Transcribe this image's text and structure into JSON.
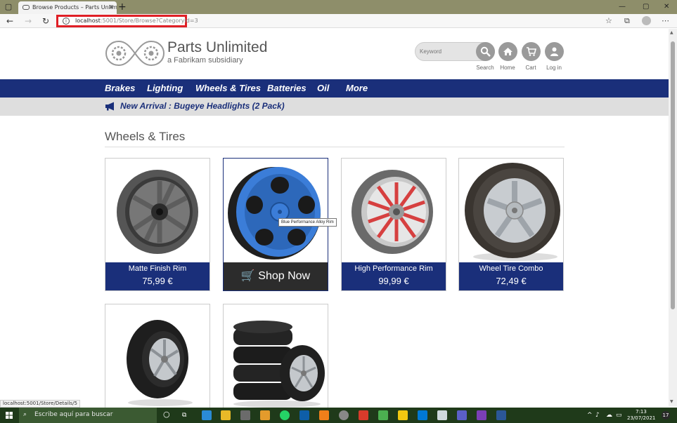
{
  "browser": {
    "tab_title": "Browse Products – Parts Unlimited",
    "url_host": "localhost",
    "url_path": ":5001/Store/Browse?CategoryId=3",
    "status_url": "localhost:5001/Store/Details/5"
  },
  "header": {
    "brand_name": "Parts Unlimited",
    "brand_sub": "a Fabrikam subsidiary",
    "search_placeholder": "Keyword",
    "search_label": "Search",
    "home_label": "Home",
    "cart_label": "Cart",
    "login_label": "Log in"
  },
  "nav": {
    "items": [
      "Brakes",
      "Lighting",
      "Wheels & Tires",
      "Batteries",
      "Oil",
      "More"
    ]
  },
  "announcement": "New Arrival : Bugeye Headlights (2 Pack)",
  "category_title": "Wheels & Tires",
  "products": [
    {
      "name": "Matte Finish Rim",
      "price": "75,99 €"
    },
    {
      "name": "Blue Performance Alloy Rim",
      "shop_now": "Shop Now"
    },
    {
      "name": "High Performance Rim",
      "price": "99,99 €"
    },
    {
      "name": "Wheel Tire Combo",
      "price": "72,49 €"
    }
  ],
  "taskbar": {
    "search_placeholder": "Escribe aquí para buscar",
    "time": "7:13",
    "date": "23/07/2021",
    "notifications": "17"
  },
  "colors": {
    "nav_blue": "#1a2f7a",
    "url_highlight": "#e01f26",
    "shop_now_bg": "#2c2c2c",
    "rim_blue": "#3b7dd8",
    "rim_red": "#d64040"
  }
}
